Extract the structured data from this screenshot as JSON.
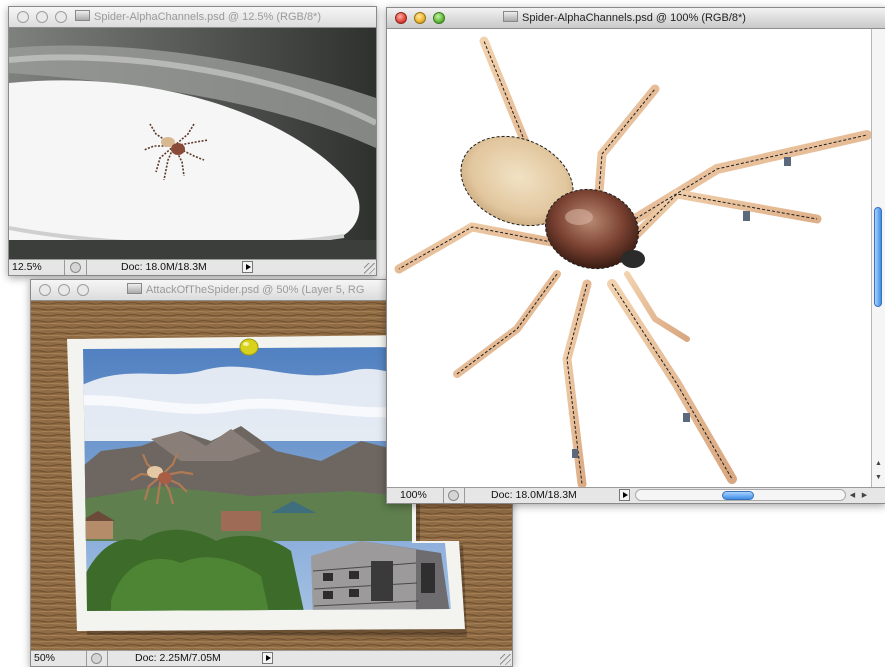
{
  "windows": {
    "small": {
      "title": "Spider-AlphaChannels.psd @ 12.5% (RGB/8*)",
      "zoom": "12.5%",
      "doc": "Doc: 18.0M/18.3M"
    },
    "attack": {
      "title": "AttackOfTheSpider.psd @ 50% (Layer 5, RG",
      "zoom": "50%",
      "doc": "Doc: 2.25M/7.05M"
    },
    "main": {
      "title": "Spider-AlphaChannels.psd @ 100% (RGB/8*)",
      "zoom": "100%",
      "doc": "Doc: 18.0M/18.3M"
    }
  },
  "icons": [
    "close-icon",
    "minimize-icon",
    "zoom-icon",
    "document-proxy-icon",
    "info-icon",
    "menu-arrow-icon",
    "resize-grip-icon"
  ],
  "colors": {
    "close": "#e0443a",
    "minimize": "#eab52c",
    "zoom": "#5fb93a",
    "scroll_thumb": "#3f8ee8"
  }
}
